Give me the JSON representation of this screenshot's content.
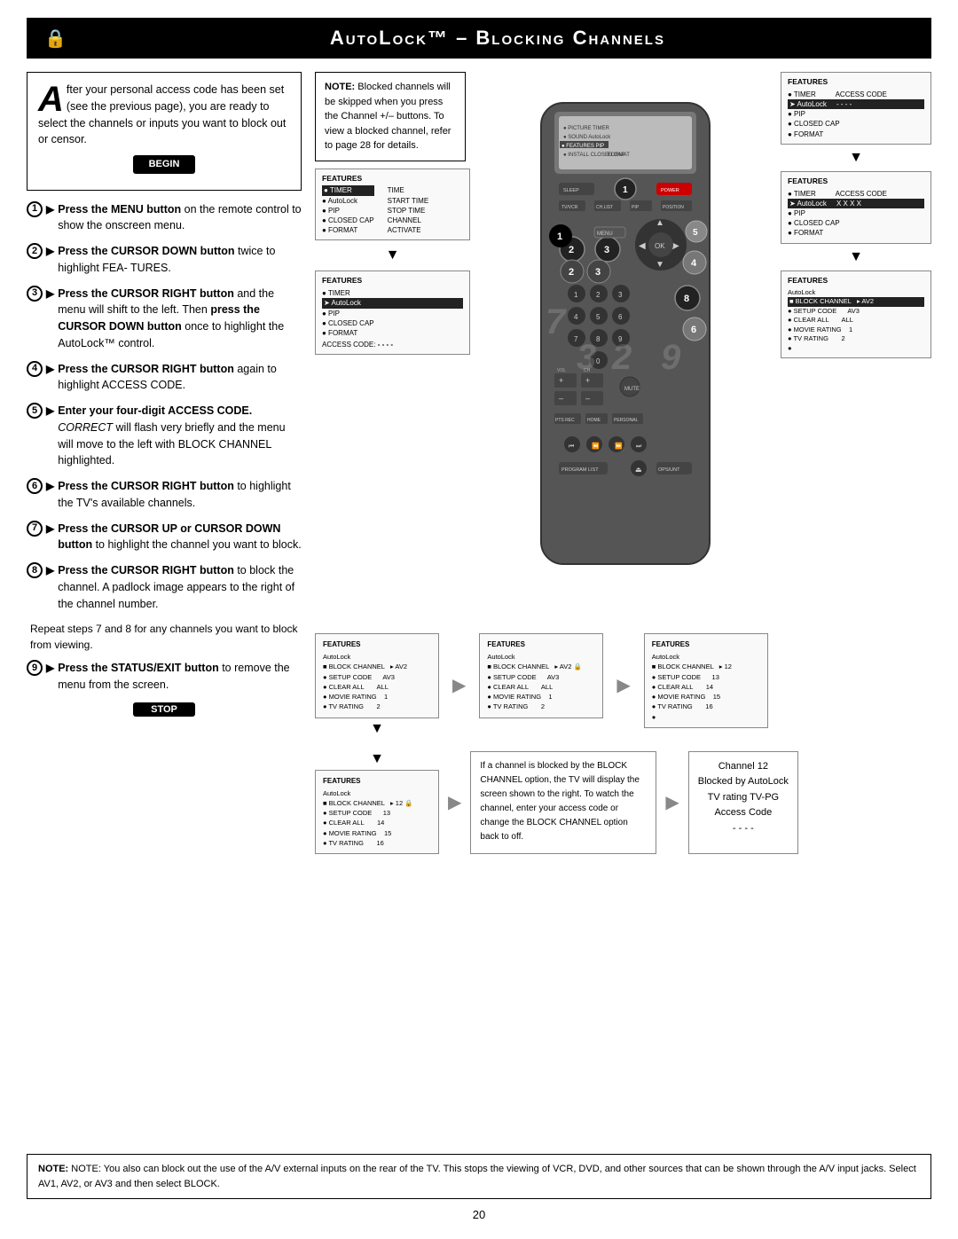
{
  "header": {
    "title": "AutoLock™ – Blocking Channels",
    "lock_icon": "🔒"
  },
  "intro": {
    "drop_cap": "A",
    "text": "fter your personal access code has been set (see the previous page), you are ready to select the channels or inputs you want to block out or censor."
  },
  "begin_label": "BEGIN",
  "stop_label": "STOP",
  "steps": [
    {
      "num": "1",
      "content": "Press the MENU button on the remote control to show the onscreen menu."
    },
    {
      "num": "2",
      "content": "Press the CURSOR DOWN button twice to highlight FEA- TURES."
    },
    {
      "num": "3",
      "content": "Press the CURSOR RIGHT button and the menu will shift to the left. Then press the CURSOR DOWN button once to highlight the AutoLock™ control."
    },
    {
      "num": "4",
      "content": "Press the CURSOR RIGHT button again to highlight ACCESS CODE."
    },
    {
      "num": "5",
      "content": "Enter your four-digit ACCESS CODE. CORRECT will flash very briefly and the menu will move to the left with BLOCK CHANNEL highlighted."
    },
    {
      "num": "6",
      "content": "Press the CURSOR RIGHT button to highlight the TV's available channels."
    },
    {
      "num": "7",
      "content": "Press the CURSOR UP or CURSOR DOWN button to highlight the channel you want to block."
    },
    {
      "num": "8",
      "content": "Press the CURSOR RIGHT button to block the channel. A padlock image appears to the right of the channel number."
    },
    {
      "num": "9",
      "content": "Press the STATUS/EXIT button to remove the menu from the screen."
    }
  ],
  "repeat_text": "Repeat steps 7 and 8 for any channels you want to block from viewing.",
  "note_blocked": {
    "title": "NOTE:",
    "text": "Blocked channels will be skipped when you press the Channel +/– buttons. To view a blocked channel, refer to page 28 for details."
  },
  "right_panels": {
    "panel1": {
      "title": "FEATURES",
      "items": [
        {
          "bullet": "●",
          "label": "TIMER",
          "highlighted": true
        },
        {
          "bullet": "●",
          "label": "AutoLock"
        },
        {
          "bullet": "●",
          "label": "PIP"
        },
        {
          "bullet": "●",
          "label": "CLOSED CAP"
        },
        {
          "bullet": "●",
          "label": "FORMAT"
        }
      ],
      "right_cols": [
        {
          "label": "TIME"
        },
        {
          "label": "START TIME"
        },
        {
          "label": "STOP TIME"
        },
        {
          "label": "CHANNEL"
        },
        {
          "label": "ACTIVATE"
        }
      ]
    },
    "panel2": {
      "title": "FEATURES",
      "items": [
        {
          "bullet": "●",
          "label": "TIMER"
        },
        {
          "bullet": "➤",
          "label": "AutoLock",
          "highlighted": true
        },
        {
          "bullet": "●",
          "label": "PIP"
        },
        {
          "bullet": "●",
          "label": "CLOSED CAP"
        },
        {
          "bullet": "●",
          "label": "FORMAT"
        }
      ],
      "access_code": "- - - -"
    },
    "panel3": {
      "title": "FEATURES",
      "items": [
        {
          "bullet": "●",
          "label": "TIMER"
        },
        {
          "bullet": "➤",
          "label": "AutoLock",
          "highlighted": true
        },
        {
          "bullet": "●",
          "label": "PIP"
        },
        {
          "bullet": "●",
          "label": "CLOSED CAP"
        },
        {
          "bullet": "●",
          "label": "FORMAT"
        }
      ],
      "access_code": "- - - -"
    },
    "panel4": {
      "title": "FEATURES",
      "items": [
        {
          "bullet": "●",
          "label": "TIMER"
        },
        {
          "bullet": "➤",
          "label": "AutoLock",
          "highlighted": true
        },
        {
          "bullet": "●",
          "label": "PIP"
        },
        {
          "bullet": "●",
          "label": "CLOSED CAP"
        },
        {
          "bullet": "●",
          "label": "FORMAT"
        }
      ],
      "access_code": "X X X X"
    },
    "panel5": {
      "title": "FEATURES",
      "items": [
        {
          "bullet": "●",
          "label": "AutoLock"
        },
        {
          "bullet": "■",
          "label": "BLOCK CHANNEL",
          "highlighted": true,
          "value": "▸ AV2"
        },
        {
          "bullet": "●",
          "label": "SETUP CODE",
          "value": "AV3"
        },
        {
          "bullet": "●",
          "label": "CLEAR ALL",
          "value": "ALL"
        },
        {
          "bullet": "●",
          "label": "MOVIE RATING",
          "value": "1"
        },
        {
          "bullet": "●",
          "label": "TV RATING",
          "value": "2"
        }
      ]
    }
  },
  "bottom_panels": {
    "panel_locked_a": {
      "title": "FEATURES",
      "subtitle": "AutoLock",
      "items": [
        {
          "bullet": "■",
          "label": "BLOCK CHANNEL",
          "value": "▸ AV2 🔒"
        },
        {
          "bullet": "●",
          "label": "SETUP CODE",
          "value": "AV3"
        },
        {
          "bullet": "●",
          "label": "CLEAR ALL",
          "value": "ALL"
        },
        {
          "bullet": "●",
          "label": "MOVIE RATING",
          "value": "1"
        },
        {
          "bullet": "●",
          "label": "TV RATING",
          "value": "2"
        }
      ]
    },
    "panel_locked_b": {
      "title": "FEATURES",
      "subtitle": "AutoLock",
      "items": [
        {
          "bullet": "■",
          "label": "BLOCK CHANNEL",
          "value": "▸ AV2 🔒"
        },
        {
          "bullet": "●",
          "label": "SETUP CODE",
          "value": "AV3"
        },
        {
          "bullet": "●",
          "label": "CLEAR ALL",
          "value": "ALL"
        },
        {
          "bullet": "●",
          "label": "MOVIE RATING",
          "value": "1"
        },
        {
          "bullet": "●",
          "label": "TV RATING",
          "value": "2"
        }
      ]
    },
    "panel_channels": {
      "title": "FEATURES",
      "subtitle": "AutoLock",
      "items": [
        {
          "bullet": "■",
          "label": "BLOCK CHANNEL",
          "value": "▸ 12"
        },
        {
          "bullet": "●",
          "label": "SETUP CODE",
          "value": "13"
        },
        {
          "bullet": "●",
          "label": "CLEAR ALL",
          "value": "14"
        },
        {
          "bullet": "●",
          "label": "MOVIE RATING",
          "value": "15"
        },
        {
          "bullet": "●",
          "label": "TV RATING",
          "value": "16"
        }
      ]
    },
    "panel_bottom_left": {
      "title": "FEATURES",
      "subtitle": "AutoLock",
      "items": [
        {
          "bullet": "■",
          "label": "BLOCK CHANNEL",
          "value": "▸ 12 🔒"
        },
        {
          "bullet": "●",
          "label": "SETUP CODE",
          "value": "13"
        },
        {
          "bullet": "●",
          "label": "CLEAR ALL",
          "value": "14"
        },
        {
          "bullet": "●",
          "label": "MOVIE RATING",
          "value": "15"
        },
        {
          "bullet": "●",
          "label": "TV RATING",
          "value": "16"
        }
      ]
    },
    "info_text": "If a channel is blocked by the BLOCK CHANNEL option, the TV will display the screen shown to the right. To watch the channel, enter your access code or change the BLOCK CHANNEL option back to off.",
    "channel_blocked_info": {
      "line1": "Channel 12",
      "line2": "Blocked by AutoLock",
      "line3": "TV rating TV-PG",
      "line4": "Access Code",
      "line5": "- - - -"
    }
  },
  "footer": {
    "note": "NOTE:  You also can block out the use of the A/V external inputs on the rear of the TV.  This stops the viewing of VCR, DVD, and other sources that can be shown through the A/V input jacks. Select AV1, AV2, or AV3 and then select BLOCK."
  },
  "page_number": "20"
}
